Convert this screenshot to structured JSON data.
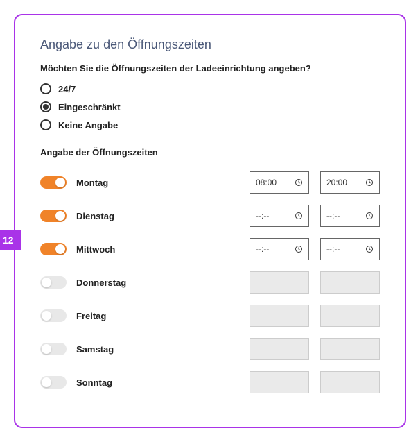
{
  "badge": "12",
  "title": "Angabe zu den Öffnungszeiten",
  "question": "Möchten Sie die Öffnungszeiten der Ladeeinrichtung angeben?",
  "radios": [
    {
      "label": "24/7",
      "checked": false
    },
    {
      "label": "Eingeschränkt",
      "checked": true
    },
    {
      "label": "Keine Angabe",
      "checked": false
    }
  ],
  "subheading": "Angabe der Öffnungszeiten",
  "emptyTime": "--:--",
  "days": [
    {
      "name": "Montag",
      "on": true,
      "from": "08:00",
      "to": "20:00"
    },
    {
      "name": "Dienstag",
      "on": true,
      "from": "--:--",
      "to": "--:--"
    },
    {
      "name": "Mittwoch",
      "on": true,
      "from": "--:--",
      "to": "--:--"
    },
    {
      "name": "Donnerstag",
      "on": false,
      "from": "",
      "to": ""
    },
    {
      "name": "Freitag",
      "on": false,
      "from": "",
      "to": ""
    },
    {
      "name": "Samstag",
      "on": false,
      "from": "",
      "to": ""
    },
    {
      "name": "Sonntag",
      "on": false,
      "from": "",
      "to": ""
    }
  ]
}
